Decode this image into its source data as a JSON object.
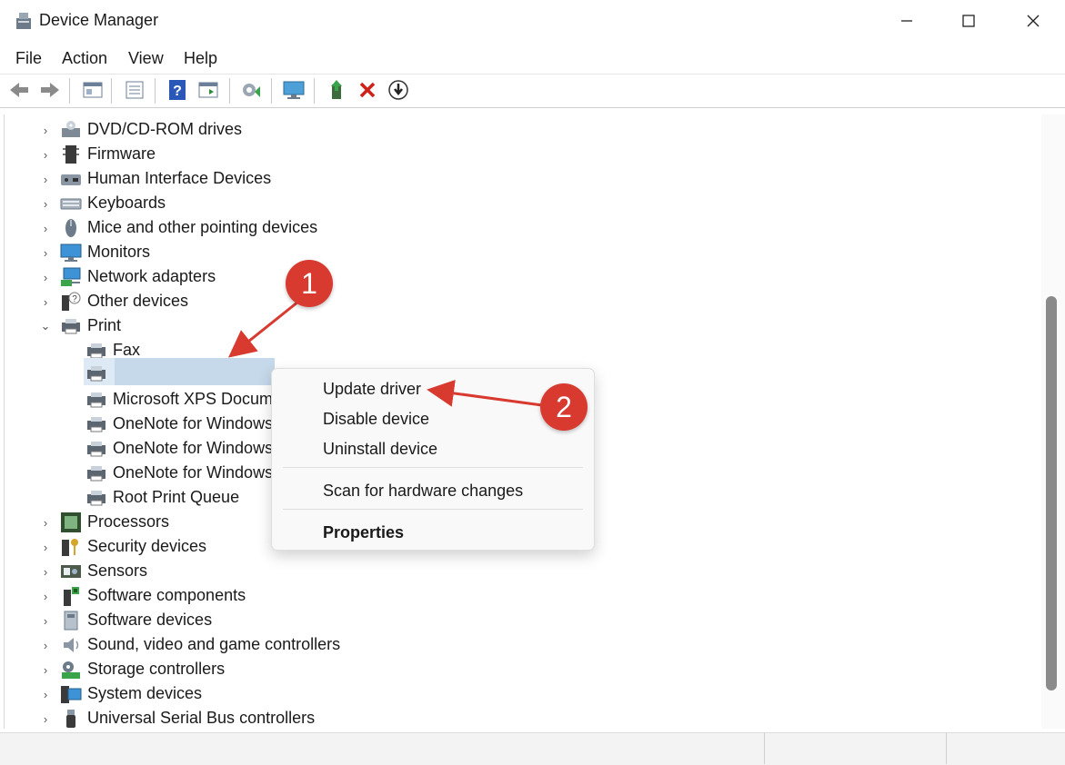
{
  "window": {
    "title": "Device Manager"
  },
  "menu": [
    "File",
    "Action",
    "View",
    "Help"
  ],
  "tree": {
    "categories_top": [
      {
        "label": "DVD/CD-ROM drives",
        "icon": "dvd-drive-icon"
      },
      {
        "label": "Firmware",
        "icon": "firmware-chip-icon"
      },
      {
        "label": "Human Interface Devices",
        "icon": "hid-icon"
      },
      {
        "label": "Keyboards",
        "icon": "keyboard-icon"
      },
      {
        "label": "Mice and other pointing devices",
        "icon": "mouse-icon"
      },
      {
        "label": "Monitors",
        "icon": "monitor-icon"
      },
      {
        "label": "Network adapters",
        "icon": "network-adapter-icon"
      },
      {
        "label": "Other devices",
        "icon": "unknown-device-icon"
      },
      {
        "label": "Print",
        "icon": "printer-icon"
      }
    ],
    "print_children": [
      {
        "label": "Fax"
      },
      {
        "label": ""
      },
      {
        "label": "Microsoft XPS Docume"
      },
      {
        "label": "OneNote for Windows"
      },
      {
        "label": "OneNote for Windows"
      },
      {
        "label": "OneNote for Windows"
      },
      {
        "label": "Root Print Queue"
      }
    ],
    "categories_bottom": [
      {
        "label": "Processors",
        "icon": "processor-icon"
      },
      {
        "label": "Security devices",
        "icon": "security-key-icon"
      },
      {
        "label": "Sensors",
        "icon": "sensor-icon"
      },
      {
        "label": "Software components",
        "icon": "software-component-icon"
      },
      {
        "label": "Software devices",
        "icon": "software-device-icon"
      },
      {
        "label": "Sound, video and game controllers",
        "icon": "speaker-icon"
      },
      {
        "label": "Storage controllers",
        "icon": "storage-controller-icon"
      },
      {
        "label": "System devices",
        "icon": "system-device-icon"
      },
      {
        "label": "Universal Serial Bus controllers",
        "icon": "usb-icon"
      }
    ]
  },
  "context_menu": {
    "update": "Update driver",
    "disable": "Disable device",
    "uninstall": "Uninstall device",
    "scan": "Scan for hardware changes",
    "properties": "Properties"
  },
  "annotations": {
    "one": "1",
    "two": "2"
  },
  "colors": {
    "accent_badge": "#d93a2f",
    "selection": "#c5d9ea",
    "arrow": "#d93a2f"
  }
}
